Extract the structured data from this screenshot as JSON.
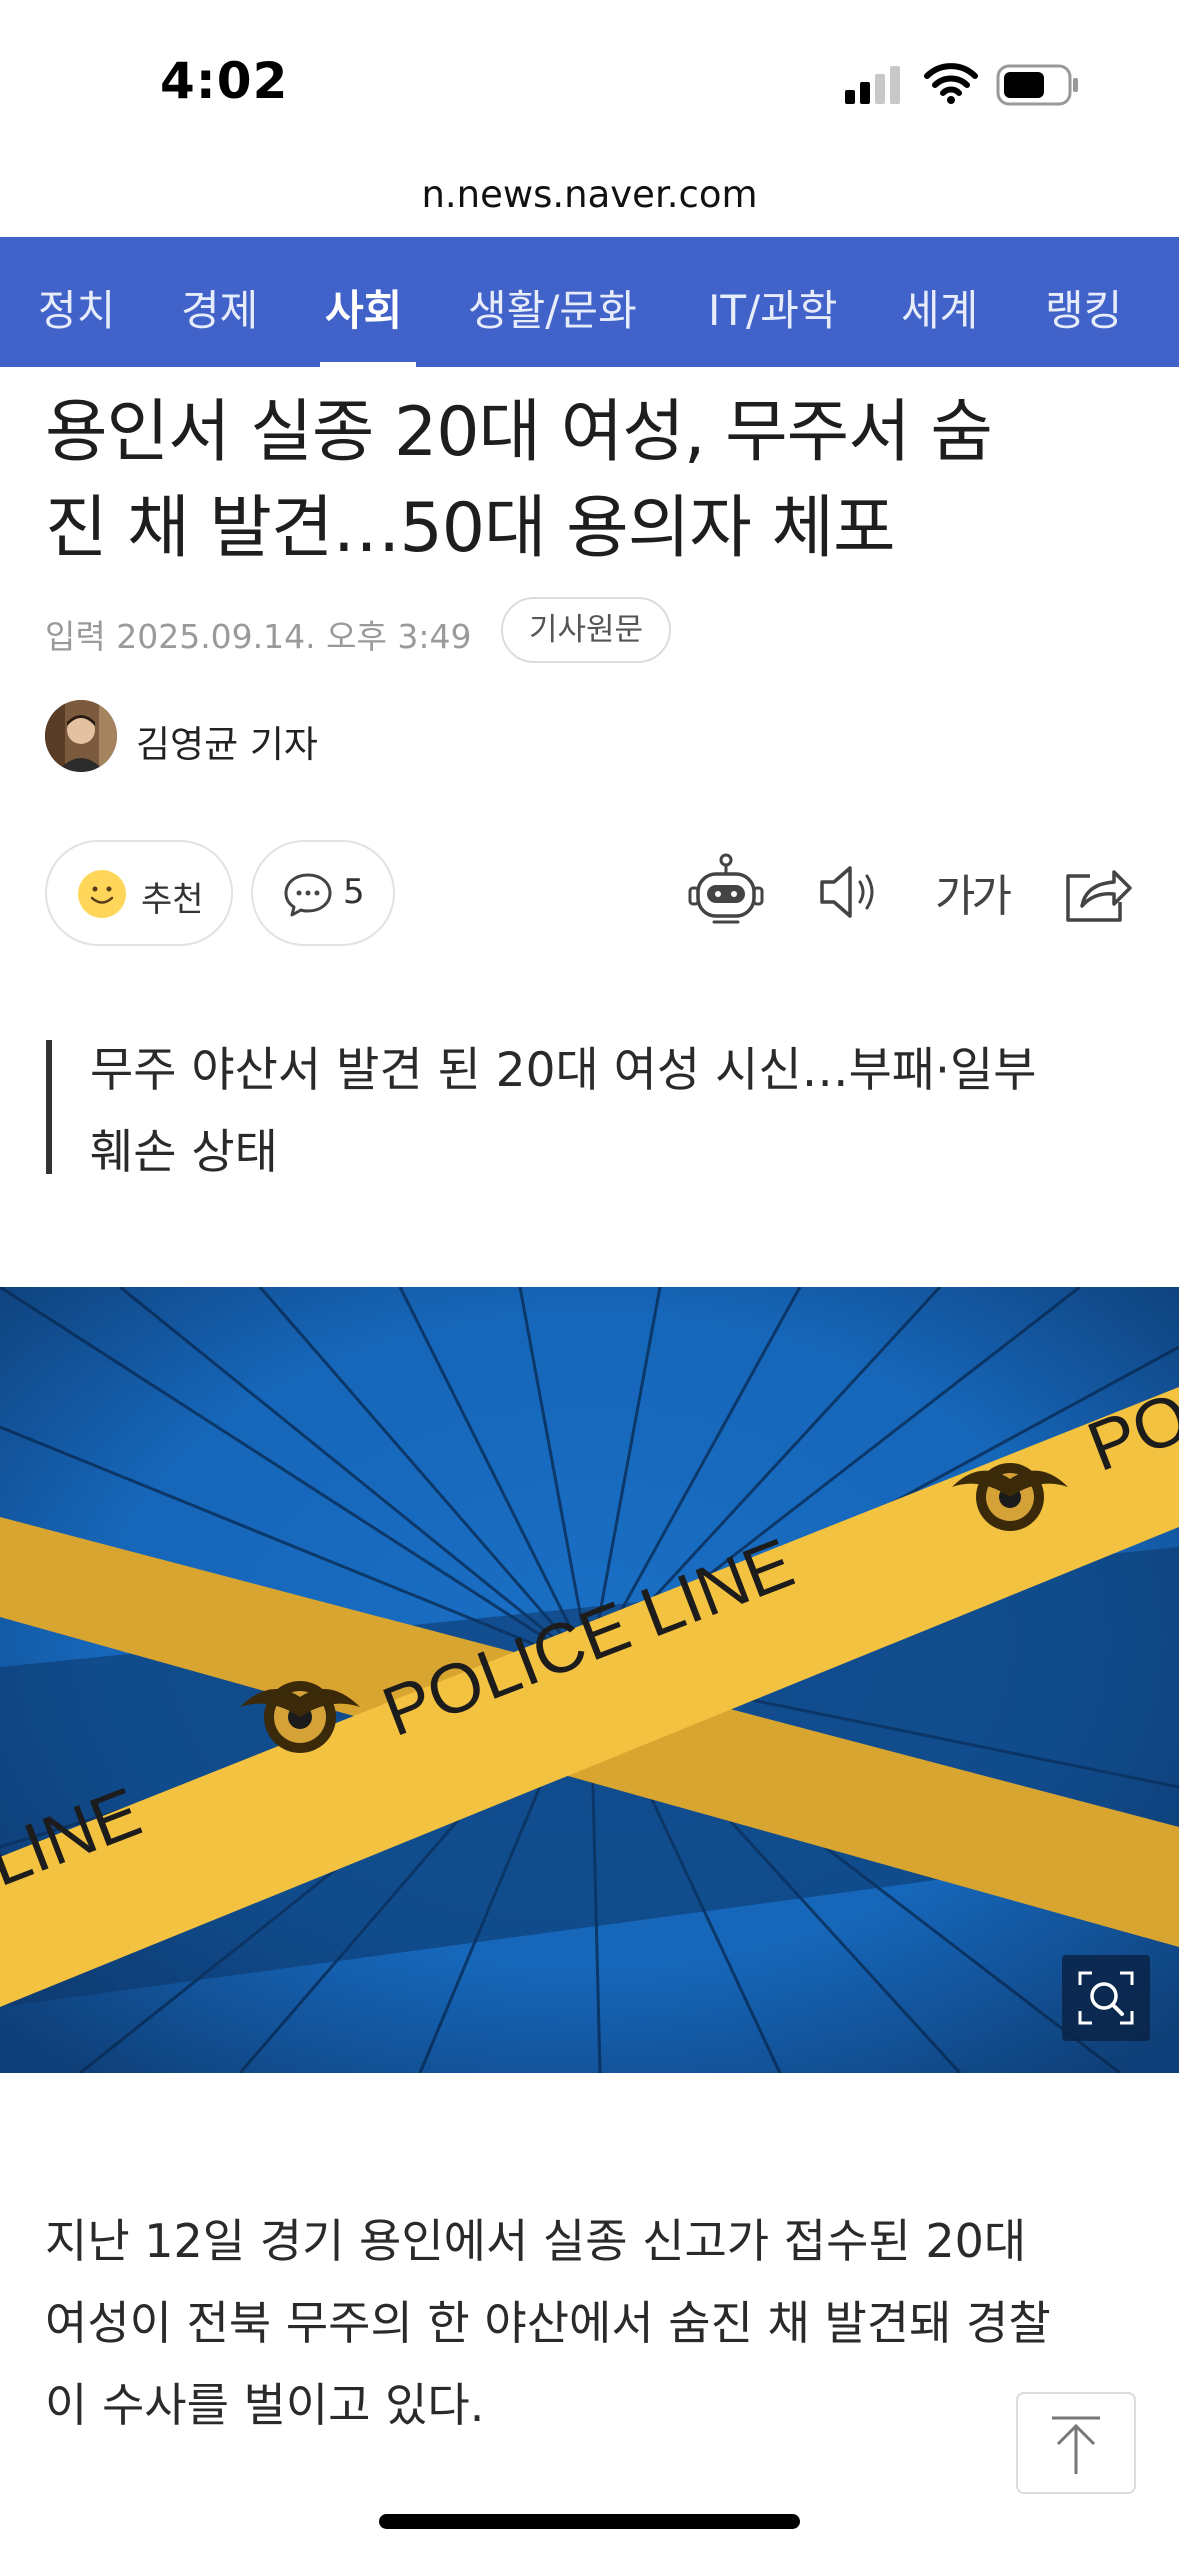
{
  "status_bar": {
    "time": "4:02"
  },
  "browser": {
    "url": "n.news.naver.com"
  },
  "nav": {
    "tabs": [
      {
        "label": "정치",
        "active": false
      },
      {
        "label": "경제",
        "active": false
      },
      {
        "label": "사회",
        "active": true
      },
      {
        "label": "생활/문화",
        "active": false
      },
      {
        "label": "IT/과학",
        "active": false
      },
      {
        "label": "세계",
        "active": false
      },
      {
        "label": "랭킹",
        "active": false
      }
    ],
    "color": "#4162c8"
  },
  "article": {
    "headline_line1": "용인서 실종 20대 여성, 무주서 숨",
    "headline_line2": "진 채 발견…50대 용의자 체포",
    "pubdate": "입력 2025.09.14. 오후 3:49",
    "original_link": "기사원문",
    "reporter": "김영균 기자",
    "like_label": "추천",
    "comment_count": "5",
    "font_size_label": "가가",
    "summary_line1": "무주 야산서 발견 된 20대 여성 시신…부패·일부",
    "summary_line2": "훼손 상태",
    "image_text_main": "POLICE LINE",
    "image_text_left": "LINE",
    "image_text_right": "PO",
    "body_line1": "지난 12일 경기 용인에서 실종 신고가 접수된 20대",
    "body_line2": "여성이 전북 무주의 한 야산에서 숨진 채 발견돼 경찰",
    "body_line3": "이 수사를 벌이고 있다."
  },
  "icons": [
    "signal-icon",
    "wifi-icon",
    "battery-icon",
    "smile-icon",
    "comment-icon",
    "robot-icon",
    "speaker-icon",
    "share-icon",
    "zoom-icon",
    "arrow-up-icon"
  ]
}
